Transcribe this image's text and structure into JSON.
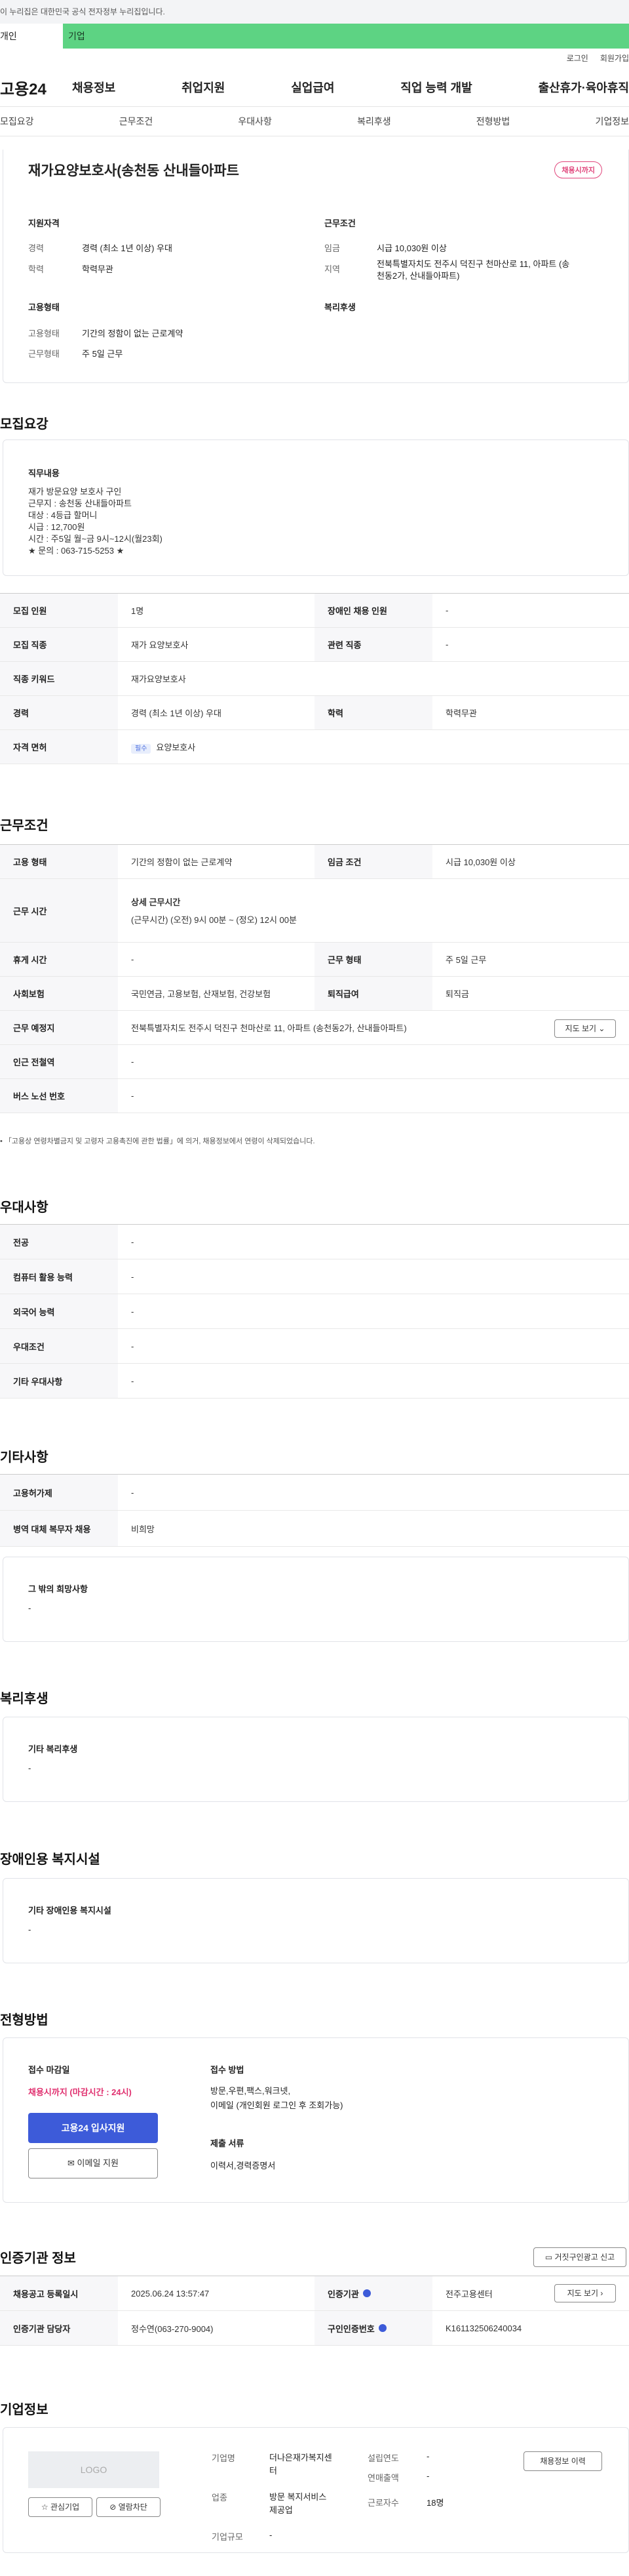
{
  "notice": "이 누리집은 대한민국 공식 전자정부 누리집입니다.",
  "userbar": {
    "personal": "개인",
    "company": "기업"
  },
  "util": {
    "login": "로그인",
    "join": "회원가입"
  },
  "logo": "고용24",
  "gnb": [
    "채용정보",
    "취업지원",
    "실업급여",
    "직업 능력 개발",
    "출산휴가·육아휴직"
  ],
  "tabs": [
    "모집요강",
    "근무조건",
    "우대사항",
    "복리후생",
    "전형방법",
    "기업정보"
  ],
  "job": {
    "title": "재가요양보호사(송천동 산내들아파트",
    "badge": "채용시까지",
    "summary": {
      "qual_title": "지원자격",
      "career_k": "경력",
      "career_v": "경력 (최소 1년 이상) 우대",
      "edu_k": "학력",
      "edu_v": "학력무관",
      "emp_title": "고용형태",
      "emptype_k": "고용형태",
      "emptype_v": "기간의 정함이 없는 근로계약",
      "work_k": "근무형태",
      "work_v": "주 5일 근무",
      "cond_title": "근무조건",
      "wage_k": "임금",
      "wage_v": "시급 10,030원 이상",
      "area_k": "지역",
      "area_v1": "전북특별자치도 전주시 덕진구 천마산로 11, 아파트 (송",
      "area_v2": "천동2가, 산내들아파트)",
      "welfare_title": "복리후생"
    }
  },
  "recruit": {
    "title": "모집요강",
    "duty_title": "직무내용",
    "duty_lines": [
      "재가 방문요양 보호사 구인",
      "근무지 : 송천동 산내들아파트",
      "대상 : 4등급 할머니",
      "시급 : 12,700원",
      "시간 : 주5일 월~금 9시~12시(월23회)",
      "★ 문의 : 063-715-5253 ★"
    ],
    "rows": [
      {
        "k1": "모집 인원",
        "v1": "1명",
        "k2": "장애인 채용 인원",
        "v2": "-"
      },
      {
        "k1": "모집 직종",
        "v1": "재가 요양보호사",
        "k2": "관련 직종",
        "v2": "-"
      },
      {
        "k1": "직종 키워드",
        "v1": "재가요양보호사"
      },
      {
        "k1": "경력",
        "v1": "경력 (최소 1년 이상) 우대",
        "k2": "학력",
        "v2": "학력무관"
      },
      {
        "k1": "자격 면허",
        "tag": "필수",
        "v1": "요양보호사"
      }
    ]
  },
  "workcond": {
    "title": "근무조건",
    "r1": {
      "k1": "고용 형태",
      "v1": "기간의 정함이 없는 근로계약",
      "k2": "임금 조건",
      "v2": "시급 10,030원 이상"
    },
    "r2": {
      "k1": "근무 시간",
      "head": "상세 근무시간",
      "detail": "(근무시간) (오전) 9시 00분 ~ (정오) 12시 00분"
    },
    "r3": {
      "k1": "휴게 시간",
      "v1": "-",
      "k2": "근무 형태",
      "v2": "주 5일 근무"
    },
    "r4": {
      "k1": "사회보험",
      "v1": "국민연금, 고용보험, 산재보험, 건강보험",
      "k2": "퇴직급여",
      "v2": "퇴직금"
    },
    "r5": {
      "k1": "근무 예정지",
      "v1": "전북특별자치도 전주시 덕진구 천마산로 11, 아파트 (송천동2가, 산내들아파트)",
      "btn": "지도 보기"
    },
    "r6": {
      "k1": "인근 전철역",
      "v1": "-"
    },
    "r7": {
      "k1": "버스 노선 번호",
      "v1": "-"
    },
    "note": "「고용상 연령차별금지 및 고령자 고용촉진에 관한 법률」에 의거, 채용정보에서 연령이 삭제되었습니다."
  },
  "pref": {
    "title": "우대사항",
    "rows": [
      {
        "k": "전공",
        "v": "-"
      },
      {
        "k": "컴퓨터 활용 능력",
        "v": "-"
      },
      {
        "k": "외국어 능력",
        "v": "-"
      },
      {
        "k": "우대조건",
        "v": "-"
      },
      {
        "k": "기타 우대사항",
        "v": "-"
      }
    ]
  },
  "etc": {
    "title": "기타사항",
    "rows": [
      {
        "k": "고용허가제",
        "v": "-"
      },
      {
        "k": "병역 대체 복무자 채용",
        "v": "비희망"
      }
    ],
    "wish_title": "그 밖의 희망사항",
    "wish_v": "-"
  },
  "welfare": {
    "title": "복리후생",
    "sub": "기타 복리후생",
    "v": "-"
  },
  "disab": {
    "title": "장애인용 복지시설",
    "sub": "기타 장애인용 복지시설",
    "v": "-"
  },
  "process": {
    "title": "전형방법",
    "deadline_k": "접수 마감일",
    "deadline_v": "채용시까지 (마감시간 : 24시)",
    "apply_btn": "고용24 입사지원",
    "email_btn": "이메일 지원",
    "method_k": "접수 방법",
    "method_v1": "방문,우편,팩스,워크넷,",
    "method_v2": "이메일 (개인회원 로그인 후 조회가능)",
    "docs_k": "제출 서류",
    "docs_v": "이력서,경력증명서"
  },
  "cert": {
    "title": "인증기관 정보",
    "report_btn": "거짓구인광고 신고",
    "r1": {
      "k1": "채용공고 등록일시",
      "v1": "2025.06.24 13:57:47",
      "k2": "인증기관",
      "v2": "전주고용센터",
      "btn": "지도 보기"
    },
    "r2": {
      "k1": "인증기관 담당자",
      "v1": "정수연(063-270-9004)",
      "k2": "구인인증번호",
      "v2": "K161132506240034"
    }
  },
  "company": {
    "title": "기업정보",
    "logo": "LOGO",
    "fav_btn": "관심기업",
    "block_btn": "열람차단",
    "history_btn": "채용정보 이력",
    "name_k": "기업명",
    "name_v1": "더나은재가복지센",
    "name_v2": "터",
    "year_k": "설립연도",
    "year_v": "-",
    "biz_k": "업종",
    "biz_v1": "방문 복지서비스",
    "biz_v2": "제공업",
    "sales_k": "연매출액",
    "sales_v": "-",
    "emp_k": "근로자수",
    "emp_v": "18명",
    "size_k": "기업규모",
    "size_v": "-"
  }
}
